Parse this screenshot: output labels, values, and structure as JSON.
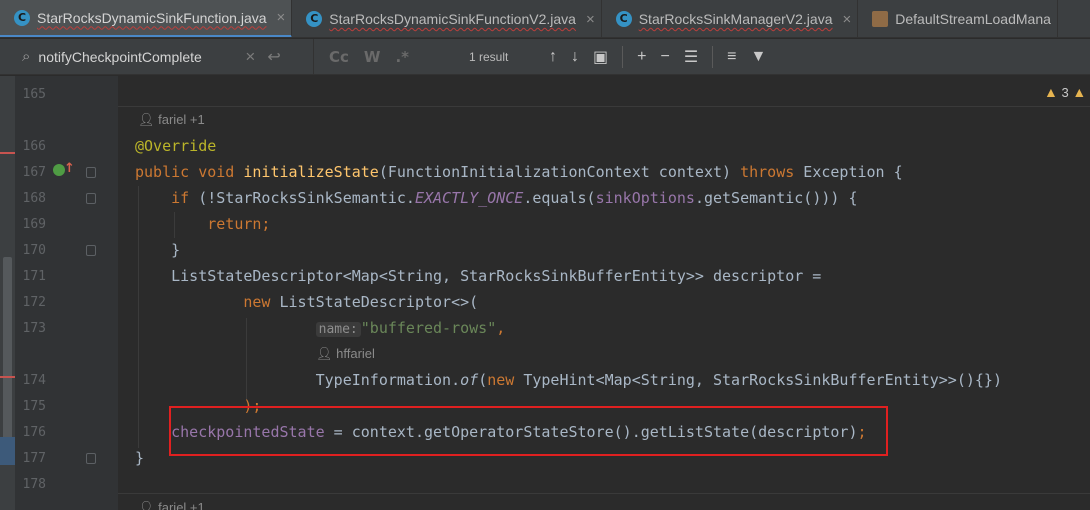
{
  "tabs": [
    {
      "label": "StarRocksDynamicSinkFunction.java",
      "active": true,
      "icon": "java-class-icon"
    },
    {
      "label": "StarRocksDynamicSinkFunctionV2.java",
      "active": false,
      "icon": "java-class-icon"
    },
    {
      "label": "StarRocksSinkManagerV2.java",
      "active": false,
      "icon": "java-class-icon"
    },
    {
      "label": "DefaultStreamLoadMana",
      "active": false,
      "icon": "library-class-icon"
    }
  ],
  "search": {
    "query": "notifyCheckpointComplete",
    "result_count": "1 result",
    "match_case": "Cc",
    "words": "W",
    "regex": ".*"
  },
  "line_numbers": [
    "165",
    "166",
    "167",
    "168",
    "169",
    "170",
    "171",
    "172",
    "173",
    "174",
    "175",
    "176",
    "177",
    "178"
  ],
  "inspections": {
    "warnings": "3"
  },
  "authors": {
    "method1": "fariel +1",
    "typehint": "hffariel",
    "method2": "fariel +1"
  },
  "code": {
    "override": "@Override",
    "kw_public": "public",
    "kw_void": "void",
    "method_name": "initializeState",
    "params_open": "(FunctionInitializationContext context) ",
    "kw_throws": "throws",
    "exception": " Exception {",
    "kw_if": "if",
    "if_text1": " (!StarRocksSinkSemantic.",
    "exactly_once": "EXACTLY_ONCE",
    "if_text2": ".equals(",
    "sink_options": "sinkOptions",
    "if_text3": ".getSemantic())) {",
    "kw_return": "return;",
    "close_brace": "}",
    "descriptor_decl": "ListStateDescriptor<Map<String, StarRocksSinkBufferEntity>> descriptor =",
    "kw_new": "new",
    "new_descriptor": " ListStateDescriptor<>(",
    "param_hint_name": "name:",
    "buffered_rows": "\"buffered-rows\"",
    "comma": ",",
    "type_info": "TypeInformation.",
    "of_method": "of",
    "type_paren": "(",
    "type_hint_rest": " TypeHint<Map<String, StarRocksSinkBufferEntity>>(){})",
    "close_paren": ");",
    "checkpointed_state": "checkpointedState",
    "assign_rest": " = context.getOperatorStateStore().getListState(descriptor)",
    "semicolon": ";",
    "method_close": "}"
  },
  "colors": {
    "keyword": "#cc7832",
    "annotation": "#bbb529",
    "method_decl": "#ffc66d",
    "field": "#9876aa",
    "string": "#6a8759",
    "highlight_box": "#e02020"
  }
}
